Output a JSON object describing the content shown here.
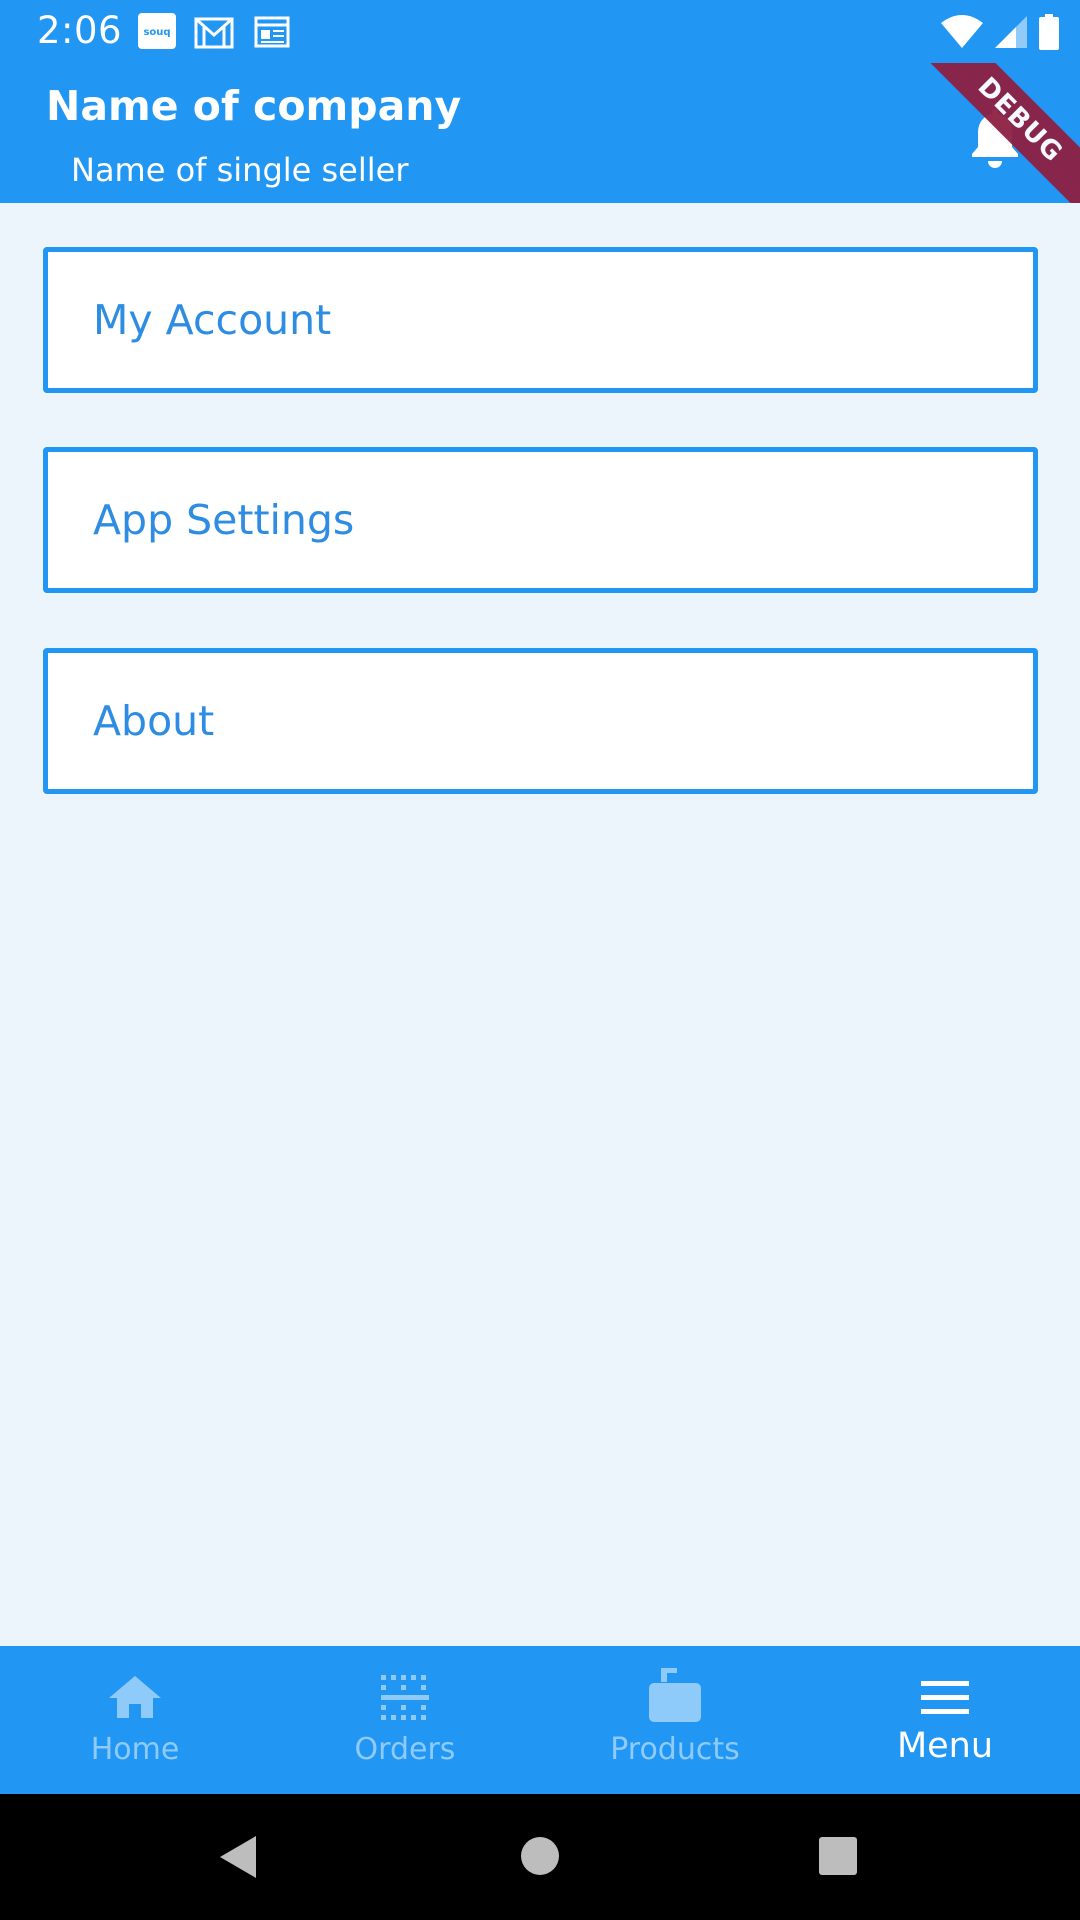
{
  "status_bar": {
    "time": "2:06",
    "notifications": [
      "souq-app-icon",
      "gmail-icon",
      "news-icon"
    ],
    "souq_text": "souq"
  },
  "app_bar": {
    "title": "Name of company",
    "subtitle": "Name of single seller",
    "notification_icon": "bell-icon",
    "debug_banner": "DEBUG"
  },
  "menu": {
    "items": [
      {
        "label": "My Account"
      },
      {
        "label": "App Settings"
      },
      {
        "label": "About"
      }
    ]
  },
  "bottom_nav": {
    "items": [
      {
        "label": "Home",
        "icon": "home-icon",
        "active": false
      },
      {
        "label": "Orders",
        "icon": "orders-icon",
        "active": false
      },
      {
        "label": "Products",
        "icon": "products-icon",
        "active": false
      },
      {
        "label": "Menu",
        "icon": "menu-icon",
        "active": true
      }
    ]
  },
  "system_nav": {
    "buttons": [
      "back-icon",
      "home-circle-icon",
      "recents-icon"
    ]
  },
  "colors": {
    "primary": "#2196F3",
    "background": "#EBF5FB",
    "card_text": "#2E8DE3",
    "nav_inactive": "#8FCBFA",
    "debug_ribbon": "#8E2043"
  }
}
